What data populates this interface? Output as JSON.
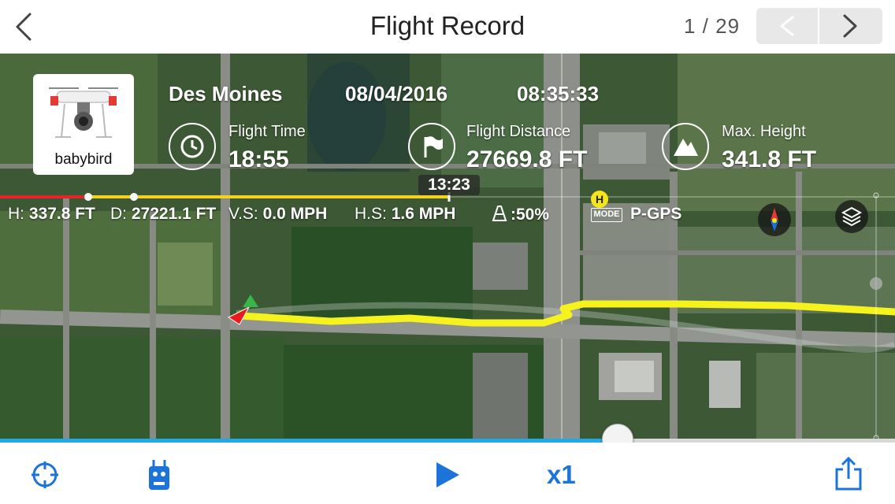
{
  "header": {
    "title": "Flight Record",
    "pager": "1 / 29"
  },
  "flight": {
    "drone_name": "babybird",
    "location": "Des Moines",
    "date": "08/04/2016",
    "time": "08:35:33",
    "flight_time_label": "Flight Time",
    "flight_time_value": "18:55",
    "flight_distance_label": "Flight Distance",
    "flight_distance_value": "27669.8 FT",
    "max_height_label": "Max. Height",
    "max_height_value": "341.8 FT",
    "timeline_time": "13:23"
  },
  "telemetry": {
    "h_label": "H:",
    "h_value": "337.8 FT",
    "d_label": "D:",
    "d_value": "27221.1 FT",
    "vs_label": "V.S:",
    "vs_value": "0.0 MPH",
    "hs_label": "H.S:",
    "hs_value": "1.6 MPH",
    "battery_value": ":50%",
    "home_marker": "H",
    "mode_label": "MODE",
    "mode_value": "P-GPS"
  },
  "playback": {
    "progress_fraction": 0.69,
    "speed": "x1"
  },
  "icons": {
    "back": "chevron-left-icon",
    "prev": "chevron-left-icon",
    "next": "chevron-right-icon",
    "locate": "crosshair-icon",
    "remote": "remote-controller-icon",
    "play": "play-icon",
    "share": "share-icon",
    "compass": "compass-icon",
    "layers": "layers-icon"
  },
  "colors": {
    "accent": "#1d74d8",
    "progress": "#1fa9e8",
    "flight_path": "#f5f21e"
  }
}
